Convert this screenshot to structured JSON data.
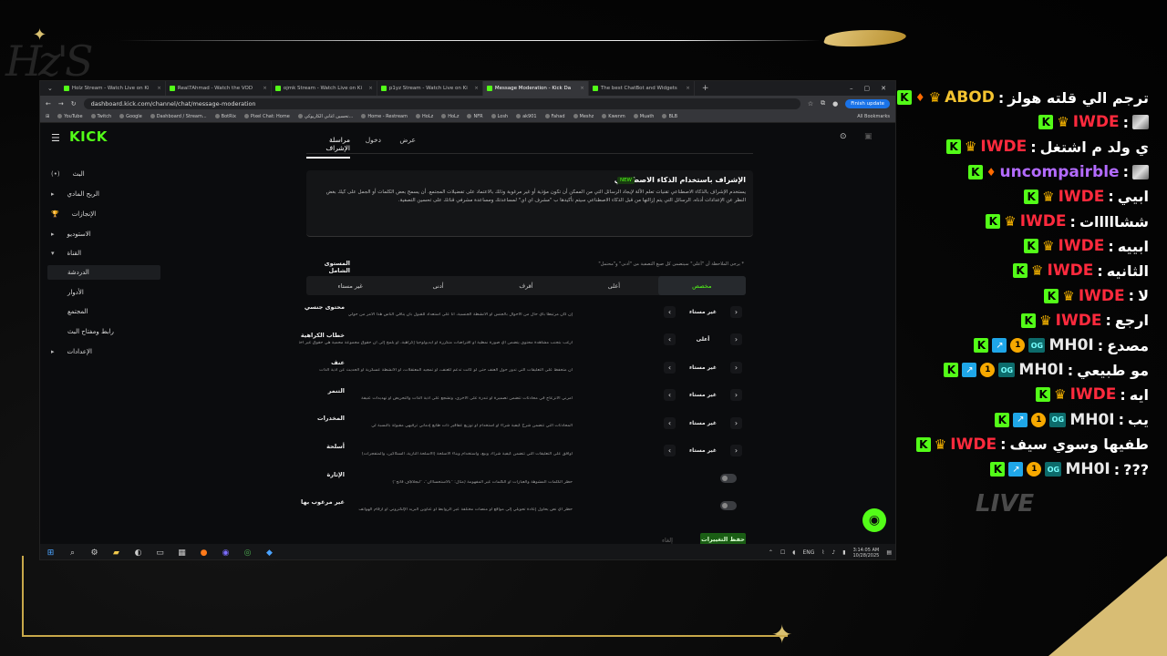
{
  "browser": {
    "tabs": [
      {
        "label": "Holz Stream - Watch Live on Ki"
      },
      {
        "label": "Real7Ahmad - Watch the VOD"
      },
      {
        "label": "ojmk Stream - Watch Live on Ki"
      },
      {
        "label": "p1yz Stream - Watch Live on Ki"
      },
      {
        "label": "Message Moderation - Kick Da"
      },
      {
        "label": "The best ChatBot and Widgets"
      }
    ],
    "url": "dashboard.kick.com/channel/chat/message-moderation",
    "finish_update": "Finish update",
    "bookmarks": [
      "YouTube",
      "Twitch",
      "Google",
      "Dashboard / Stream...",
      "BotRix",
      "Pixel Chat: Home",
      "تحسين اغاني الكاريوكي...",
      "Home - Restream",
      "HoLz",
      "HoLz",
      "NFR",
      "Losh",
      "ak901",
      "Fahad",
      "Meshz",
      "Kwenm",
      "Muath",
      "BLB"
    ],
    "all_bookmarks": "All Bookmarks"
  },
  "kick": {
    "logo": "KICK",
    "sidebar": [
      {
        "label": "البث",
        "icon": "(•)"
      },
      {
        "label": "الربح المادي",
        "icon": "▸"
      },
      {
        "label": "الإنجازات",
        "icon": "🏆"
      },
      {
        "label": "الاستوديو",
        "icon": "▸"
      },
      {
        "label": "القناة",
        "icon": "▾"
      },
      {
        "label": "الدردشة",
        "icon": ""
      },
      {
        "label": "الأدوار",
        "icon": ""
      },
      {
        "label": "المجتمع",
        "icon": ""
      },
      {
        "label": "رابط ومفتاح البث",
        "icon": ""
      },
      {
        "label": "الإعدادات",
        "icon": "▸"
      }
    ],
    "page_tabs": [
      "مراسلة الإشراف",
      "دخول",
      "عرض"
    ],
    "ai_box": {
      "title": "الإشراف باستخدام الذكاء الاصطناعي",
      "badge": "NEW",
      "description": "يستخدم الإشراف بالذكاء الاصطناعي تقنيات تعلم الآلة لإيجاد الرسائل التي من الممكن أن تكون مؤذية أو غير مرغوبة وذلك بالاعتماد على تفضيلات المجتمع. أن يسمح بعض الكلمات أو الجمل على كيك بغض النظر عن الإعدادات أدناه. الرسائل التي يتم إزالتها من قبل الذكاء الاصطناعي سيتم تأكيدها ب \"مشرف اي اي\" لمساعدتك ومساعدة مشرفي قناتك على تحسين التصفية."
    },
    "level": {
      "title": "المستوى الشامل",
      "note": "* يرجى الملاحظة أن \"أعلى\" سيتضمن كل صيغ التصفية من \"أدنى\" و\"محتمل\"",
      "options": [
        "مخصص",
        "أعلى",
        "أقرف",
        "أدنى",
        "غير مستاء"
      ]
    },
    "rules": [
      {
        "name": "محتوى جنسي",
        "desc": "إن كان مرتبطاً بأي حال من الأحوال بالجنس أو الأنشطة الجنسية، أنا على استعداد للقبول بأن ينافي الناس هذا الأمر من حولي",
        "value": "غير مستاء"
      },
      {
        "name": "خطاب الكراهية",
        "desc": "أرغب بتجنب مشاهدة محتوى يتضمن أي صورة نمطية أو افتراضات متكررة أو أيديولوجيا إكراهية، أو يلمح إلى أن حقوق مجموعة محمية هي حقوق غير أخلاقية",
        "value": "أعلى"
      },
      {
        "name": "عنف",
        "desc": "أن متحفظ على التعليقات التي تدور حول العنف حتى لو كانت تدعم للعنف، أو تمجيد المعتقلات، أو الأنشطة عسكرية أو الحديث عن أذية الذات",
        "value": "غير مستاء"
      },
      {
        "name": "التنمر",
        "desc": "أمرني الانزعاج في محادثات تتضمن تصميرة أو تندرة على الأخرى، وتشجع على أذية الذات والتحريض أو تهديدات عنيفة",
        "value": "غير مستاء"
      },
      {
        "name": "المخدرات",
        "desc": "المحادثات التي تتضمن شرح كيفية شراء أو استخدام أو توزيع عقاقير ذات طابع إدماني ترفيهي مقبولة بالنسبة لي",
        "value": "غير مستاء"
      },
      {
        "name": "أسلحة",
        "desc": "أوافق على التعليقات التي تتضمن كيفية شراء، وبيع، واستخدام وبناء الأسلحة (الأسلحة النارية، السكاكين، والمتفجرات)",
        "value": "غير مستاء"
      }
    ],
    "toggles": [
      {
        "name": "الإثارة",
        "desc": "حظر الكلمات المشوهة والعبارات أو الكلمات غير المفهومة (مثال: \"بالاستحسااان\"، \"لبجلا$ف فاتح\")"
      },
      {
        "name": "غير مرغوب بها",
        "desc": "حظر أي نص يحاول إعادة تحويلي إلى مواقع أو منصات مختلفة عبر الروابط أو عناوين البريد الإلكتروني أو أرقام الهواتف"
      }
    ],
    "cancel": "إلغاء",
    "save": "حفظ التغييرات"
  },
  "taskbar": {
    "lang": "ENG",
    "time": "3:14:05 AM",
    "date": "10/28/2025"
  },
  "chat": [
    {
      "user": "ABOD",
      "user_color": "#f4c430",
      "text": "ترجم الي قلته هولز",
      "badges": [
        "kick",
        "flame",
        "crown"
      ]
    },
    {
      "user": "IWDE",
      "user_color": "#ff2a3d",
      "text": "",
      "emote": true,
      "badges": [
        "kick",
        "crown"
      ]
    },
    {
      "user": "IWDE",
      "user_color": "#ff2a3d",
      "text": "ي ولد م اشتغل",
      "badges": [
        "kick",
        "crown"
      ]
    },
    {
      "user": "uncompairble",
      "user_color": "#b36bff",
      "text": "",
      "emote": true,
      "badges": [
        "kick",
        "flame"
      ]
    },
    {
      "user": "IWDE",
      "user_color": "#ff2a3d",
      "text": "ابيي",
      "badges": [
        "kick",
        "crown"
      ]
    },
    {
      "user": "IWDE",
      "user_color": "#ff2a3d",
      "text": "ششااااات",
      "badges": [
        "kick",
        "crown"
      ]
    },
    {
      "user": "IWDE",
      "user_color": "#ff2a3d",
      "text": "ابييه",
      "badges": [
        "kick",
        "crown"
      ]
    },
    {
      "user": "IWDE",
      "user_color": "#ff2a3d",
      "text": "الثانيه",
      "badges": [
        "kick",
        "crown"
      ]
    },
    {
      "user": "IWDE",
      "user_color": "#ff2a3d",
      "text": "لا",
      "badges": [
        "kick",
        "crown"
      ]
    },
    {
      "user": "IWDE",
      "user_color": "#ff2a3d",
      "text": "ارجع",
      "badges": [
        "kick",
        "crown"
      ]
    },
    {
      "user": "MH0I",
      "user_color": "#e8e8e8",
      "text": "مصدع",
      "badges": [
        "kick",
        "sub",
        "coin",
        "og"
      ]
    },
    {
      "user": "MH0I",
      "user_color": "#e8e8e8",
      "text": "مو طبيعي",
      "badges": [
        "kick",
        "sub",
        "coin",
        "og"
      ]
    },
    {
      "user": "IWDE",
      "user_color": "#ff2a3d",
      "text": "ايه",
      "badges": [
        "kick",
        "crown"
      ]
    },
    {
      "user": "MH0I",
      "user_color": "#e8e8e8",
      "text": "يب",
      "badges": [
        "kick",
        "sub",
        "coin",
        "og"
      ]
    },
    {
      "user": "IWDE",
      "user_color": "#ff2a3d",
      "text": "طفيها وسوي سيف",
      "badges": [
        "kick",
        "crown"
      ]
    },
    {
      "user": "MH0I",
      "user_color": "#e8e8e8",
      "text": "???",
      "badges": [
        "kick",
        "sub",
        "coin",
        "og"
      ]
    }
  ],
  "overlay": {
    "live_text": "LIVE"
  },
  "colors": {
    "kick_green": "#53fc18",
    "gold": "#d8bd74"
  }
}
